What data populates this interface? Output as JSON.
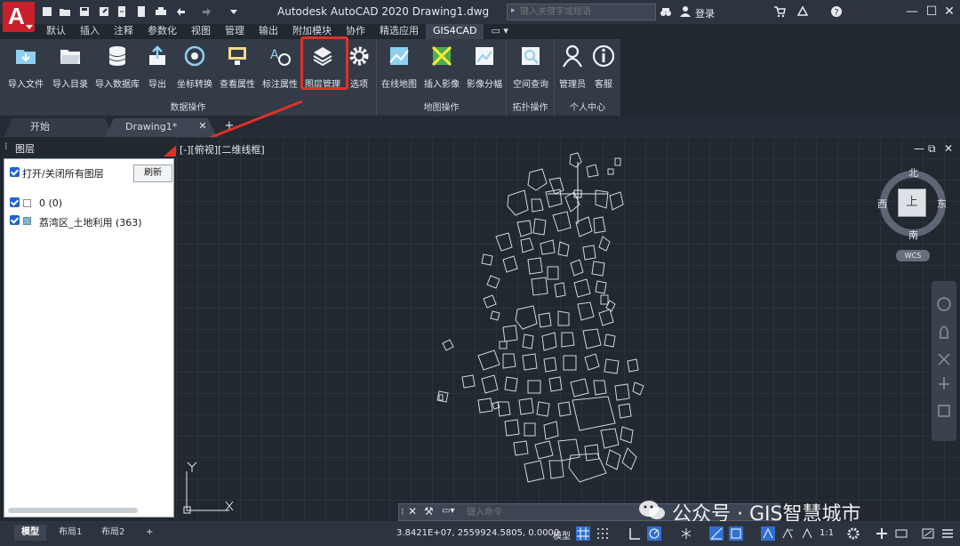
{
  "titlebar": {
    "title": "Autodesk AutoCAD 2020    Drawing1.dwg",
    "search_placeholder": "键入关键字或短语",
    "login_label": "登录"
  },
  "menu_tabs": [
    "默认",
    "插入",
    "注释",
    "参数化",
    "视图",
    "管理",
    "输出",
    "附加模块",
    "协作",
    "精选应用",
    "GIS4CAD"
  ],
  "active_menu_tab": "GIS4CAD",
  "ribbon": {
    "panels": [
      {
        "title": "数据操作",
        "tools": [
          {
            "label": "导入文件",
            "icon": "folder-import-icon"
          },
          {
            "label": "导入目录",
            "icon": "folder-open-icon"
          },
          {
            "label": "导入数据库",
            "icon": "database-icon"
          },
          {
            "label": "导出",
            "icon": "export-icon"
          },
          {
            "label": "坐标转换",
            "icon": "coordinate-transform-icon"
          },
          {
            "label": "查看属性",
            "icon": "view-attributes-icon"
          },
          {
            "label": "标注属性",
            "icon": "label-attributes-icon"
          },
          {
            "label": "图层管理",
            "icon": "layers-icon"
          },
          {
            "label": "选项",
            "icon": "gear-icon"
          }
        ]
      },
      {
        "title": "地图操作",
        "tools": [
          {
            "label": "在线地图",
            "icon": "online-map-icon"
          },
          {
            "label": "插入影像",
            "icon": "insert-image-icon"
          },
          {
            "label": "影像分幅",
            "icon": "image-tiling-icon"
          }
        ]
      },
      {
        "title": "拓扑操作",
        "tools": [
          {
            "label": "空间查询",
            "icon": "spatial-query-icon"
          }
        ]
      },
      {
        "title": "个人中心",
        "tools": [
          {
            "label": "管理员",
            "icon": "admin-user-icon"
          },
          {
            "label": "客服",
            "icon": "info-icon"
          }
        ]
      }
    ]
  },
  "doc_tabs": [
    "开始",
    "Drawing1*"
  ],
  "layer_panel": {
    "title": "图层",
    "toggle_all_label": "打开/关闭所有图层",
    "refresh_label": "刷新",
    "layers": [
      {
        "name": "0  (0)"
      },
      {
        "name": "荔湾区_土地利用   (363)"
      }
    ]
  },
  "viewport": {
    "label": "[-][俯视][二维线框]",
    "compass": {
      "north": "北",
      "south": "南",
      "east": "东",
      "west": "西",
      "top": "上"
    },
    "wcs": "WCS",
    "axis_x": "X",
    "axis_y": "Y"
  },
  "command": {
    "placeholder": "键入命令"
  },
  "watermark": "公众号 · GIS智慧城市",
  "statusbar": {
    "layout_tabs": [
      "模型",
      "布局1",
      "布局2"
    ],
    "coords": "3.8421E+07, 2559924.5805, 0.0000",
    "model_label": "模型",
    "scale": "1:1"
  },
  "colors": {
    "accent_red": "#e0302a",
    "ribbon_bg": "#333b47",
    "viewport_bg": "#212830",
    "map_line": "#cfd6de"
  }
}
